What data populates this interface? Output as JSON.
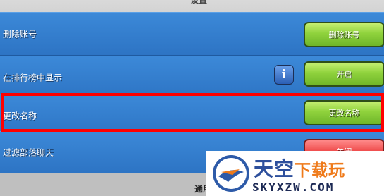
{
  "header": {
    "title_partial": "设置"
  },
  "rows": [
    {
      "label": "删除账号",
      "button": "删除账号",
      "button_color": "#8fd23c"
    },
    {
      "label": "在排行榜中显示",
      "button": "开启",
      "button_color": "#8fd23c",
      "info_glyph": "i"
    },
    {
      "label": "更改名称",
      "button": "更改名称",
      "button_color": "#8fd23c"
    },
    {
      "label": "过滤部落聊天",
      "button": "关闭",
      "button_color": "#ef4a4a"
    }
  ],
  "footer": {
    "partial_text": "通用"
  },
  "watermark": {
    "main": "天空",
    "accent": "下载玩",
    "domain": "SKYXZW.COM"
  },
  "colors": {
    "row_blue": "#2d74c4",
    "highlight": "#ff0000"
  }
}
